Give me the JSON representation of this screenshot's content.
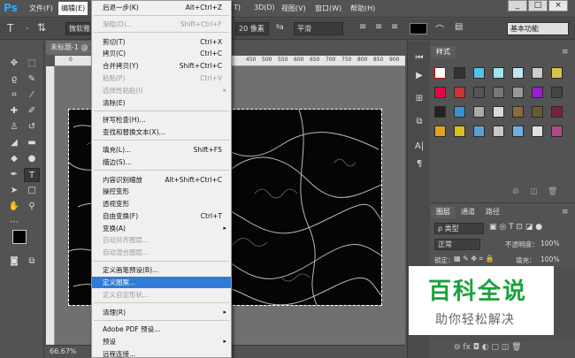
{
  "menubar": {
    "logo": "Ps",
    "items": [
      "文件(F)",
      "编辑(E)",
      "T)",
      "3D(D)",
      "视图(V)",
      "窗口(W)",
      "帮助(H)"
    ],
    "window_buttons": [
      "_",
      "□",
      "×"
    ]
  },
  "options": {
    "font_family": "微软雅",
    "font_size": "20 像素",
    "aa_label": "ªa",
    "antialias": "平滑",
    "workspace": "基本功能"
  },
  "document": {
    "tab_title": "未标题-1 @",
    "ruler_numbers": [
      "0",
      "450",
      "500",
      "550",
      "600",
      "650",
      "700",
      "750",
      "800",
      "850",
      "900"
    ],
    "zoom": "66.67%"
  },
  "styles_panel": {
    "tab": "样式"
  },
  "layers_panel": {
    "tabs": [
      "图层",
      "通道",
      "路径"
    ],
    "filter_kind": "ρ 类型",
    "blend_mode": "正常",
    "opacity_label": "不透明度：",
    "opacity_value": "100%",
    "lock_label": "锁定：",
    "fill_label": "填充：",
    "fill_value": "100%"
  },
  "edit_menu": {
    "items": [
      {
        "label": "后退一步(K)",
        "shortcut": "Alt+Ctrl+Z",
        "disabled": false
      },
      {
        "label": "渐隐(D)...",
        "shortcut": "Shift+Ctrl+F",
        "disabled": true
      },
      {
        "label": "剪切(T)",
        "shortcut": "Ctrl+X",
        "disabled": false
      },
      {
        "label": "拷贝(C)",
        "shortcut": "Ctrl+C",
        "disabled": false
      },
      {
        "label": "合并拷贝(Y)",
        "shortcut": "Shift+Ctrl+C",
        "disabled": false
      },
      {
        "label": "粘贴(P)",
        "shortcut": "Ctrl+V",
        "disabled": true
      },
      {
        "label": "选择性粘贴(I)",
        "shortcut": "",
        "disabled": true
      },
      {
        "label": "清除(E)",
        "shortcut": "",
        "disabled": false
      },
      {
        "label": "拼写检查(H)...",
        "shortcut": "",
        "disabled": false
      },
      {
        "label": "查找和替换文本(X)...",
        "shortcut": "",
        "disabled": false
      },
      {
        "label": "填充(L)...",
        "shortcut": "Shift+F5",
        "disabled": false
      },
      {
        "label": "描边(S)...",
        "shortcut": "",
        "disabled": false
      },
      {
        "label": "内容识别缩放",
        "shortcut": "Alt+Shift+Ctrl+C",
        "disabled": false
      },
      {
        "label": "操控变形",
        "shortcut": "",
        "disabled": false
      },
      {
        "label": "透视变形",
        "shortcut": "",
        "disabled": false
      },
      {
        "label": "自由变换(F)",
        "shortcut": "Ctrl+T",
        "disabled": false
      },
      {
        "label": "变换(A)",
        "shortcut": "",
        "disabled": false
      },
      {
        "label": "自动对齐图层...",
        "shortcut": "",
        "disabled": true
      },
      {
        "label": "自动混合图层...",
        "shortcut": "",
        "disabled": true
      },
      {
        "label": "定义画笔预设(B)...",
        "shortcut": "",
        "disabled": false
      },
      {
        "label": "定义图案...",
        "shortcut": "",
        "disabled": false
      },
      {
        "label": "定义自定形状...",
        "shortcut": "",
        "disabled": true
      },
      {
        "label": "清理(R)",
        "shortcut": "",
        "disabled": false
      },
      {
        "label": "Adobe PDF 预设...",
        "shortcut": "",
        "disabled": false
      },
      {
        "label": "预设",
        "shortcut": "",
        "disabled": false
      },
      {
        "label": "远程连接...",
        "shortcut": "",
        "disabled": false
      }
    ],
    "highlighted": "定义图案..."
  },
  "watermark": {
    "title": "百科全说",
    "subtitle": "助你轻松解决"
  },
  "colors": {
    "highlight": "#2f7bd6",
    "watermark_green": "#1aa33b",
    "ps_blue": "#31a8ff"
  }
}
